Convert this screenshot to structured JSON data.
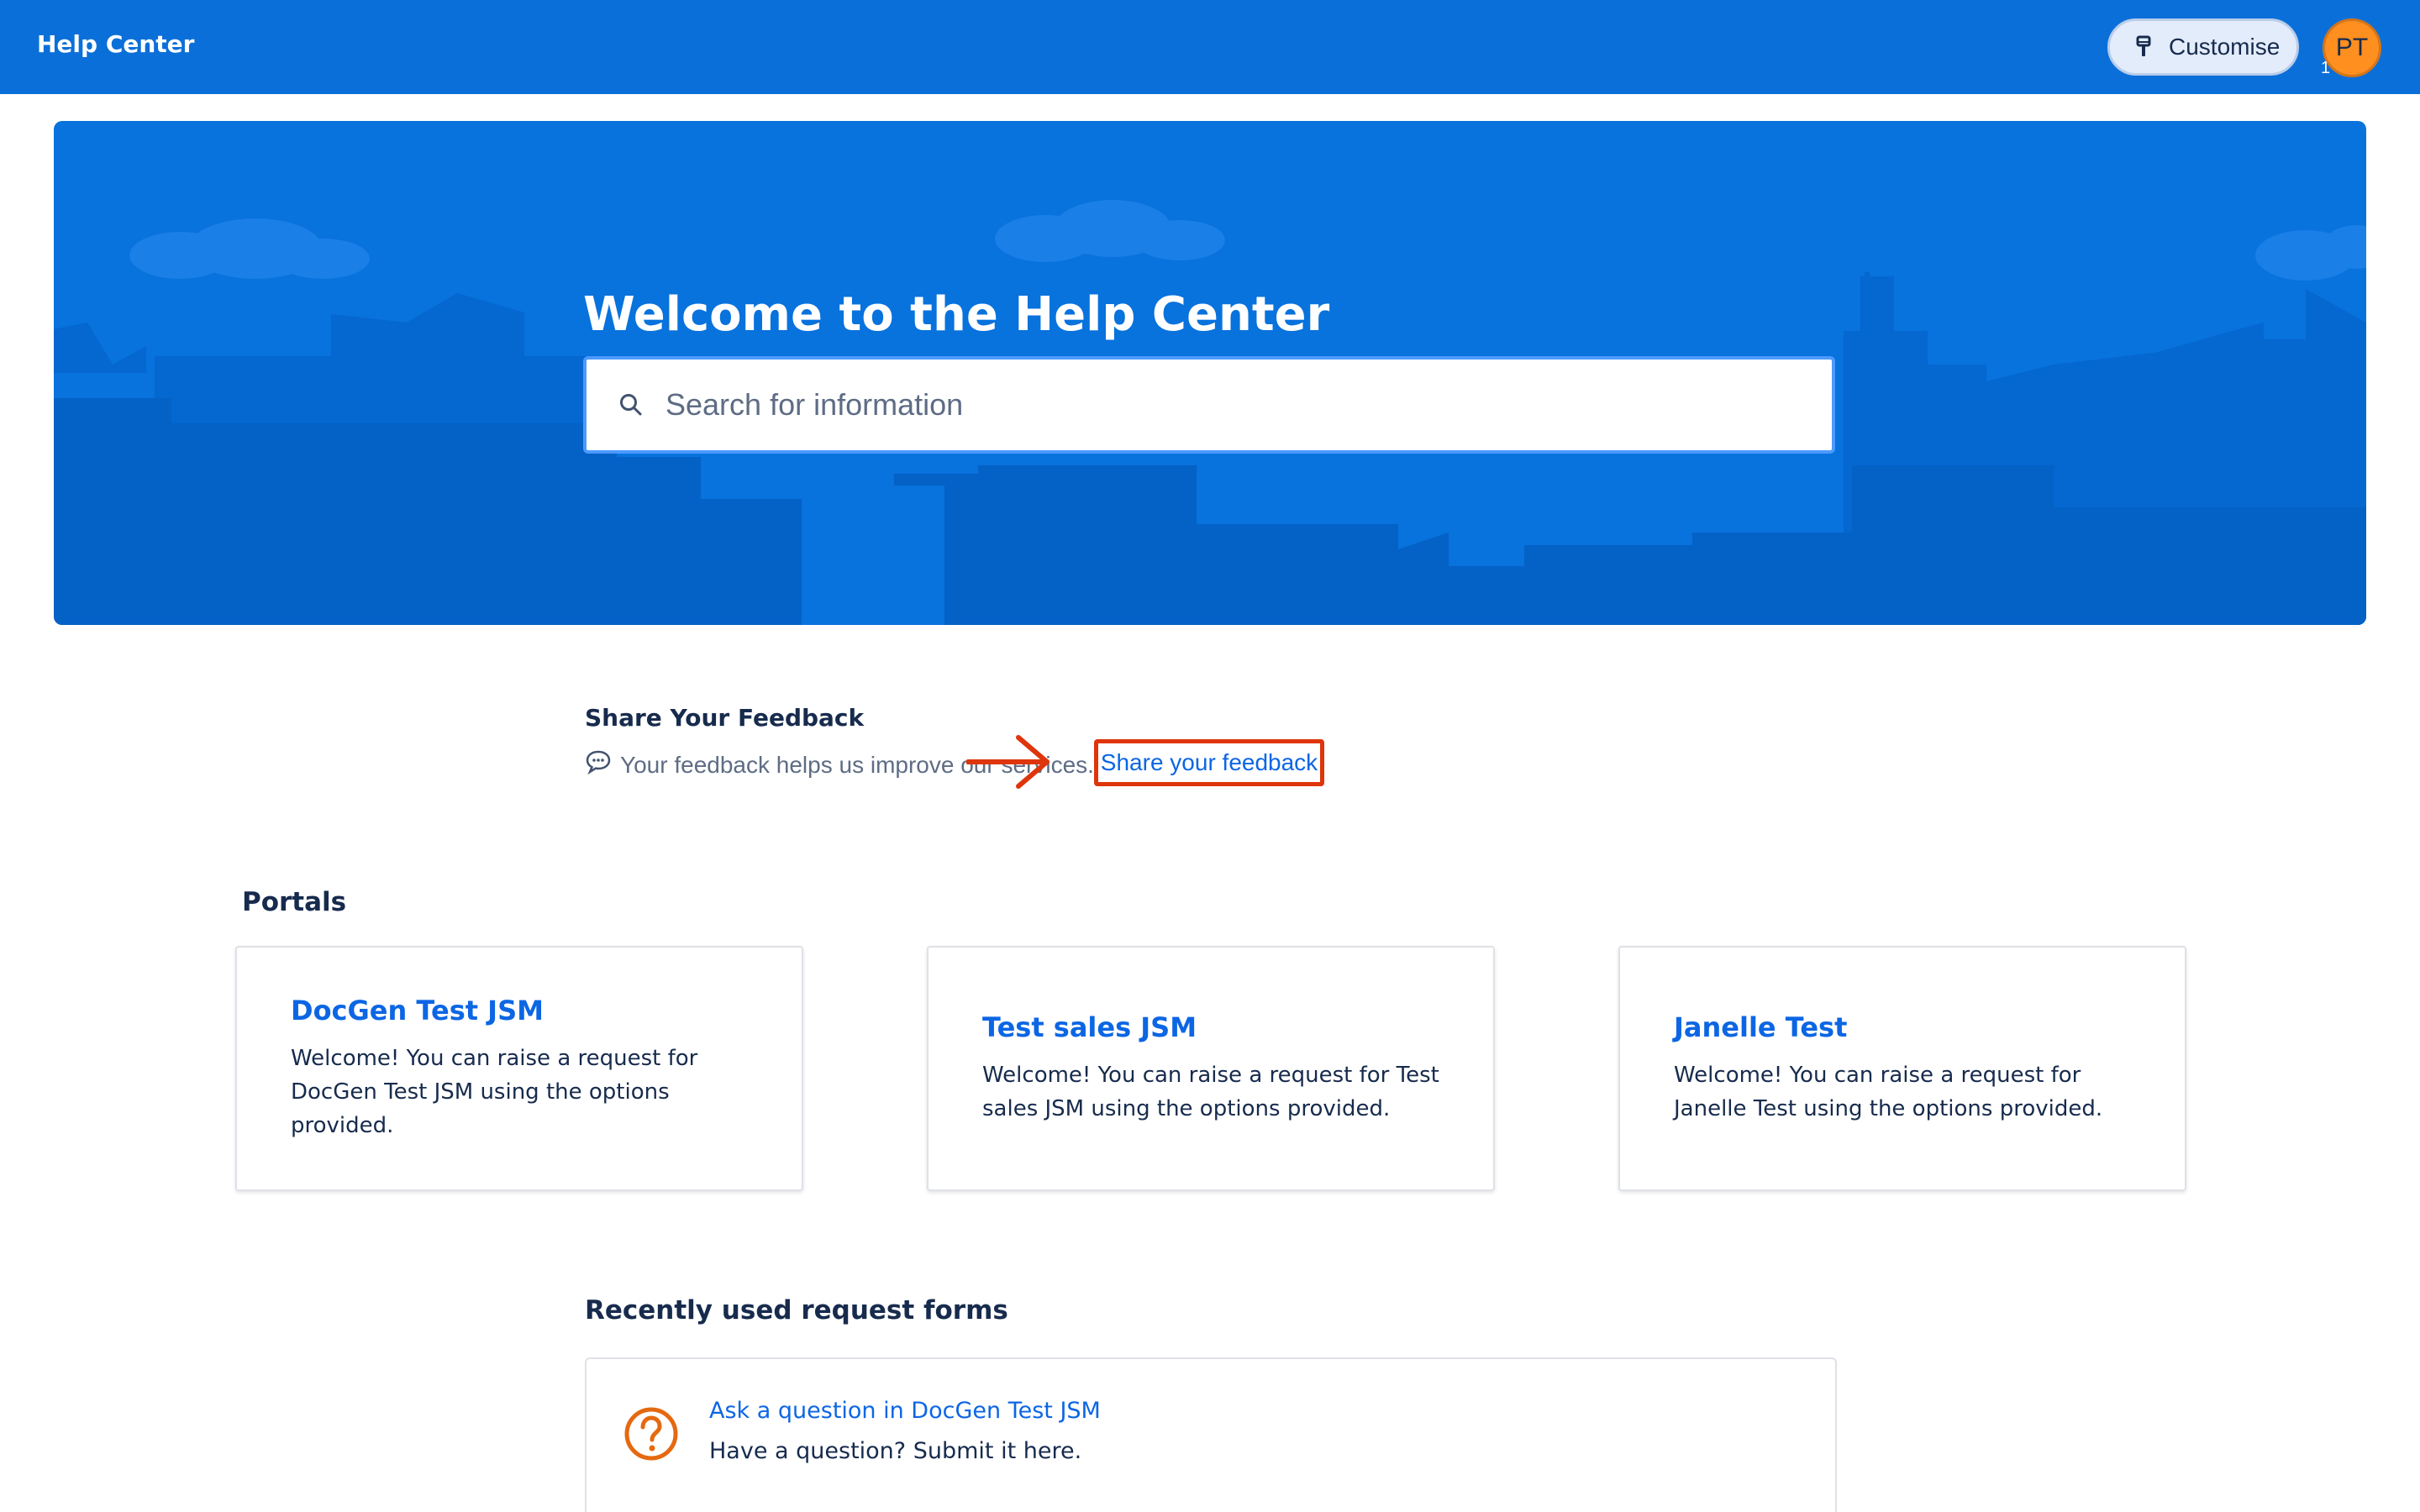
{
  "colors": {
    "topbar": "#0b6fd9",
    "hero": "#0872dd",
    "link": "#0c66e4",
    "avatar": "#ff8f1f",
    "highlight": "#de350b",
    "question_icon": "#e56910"
  },
  "header": {
    "brand": "Help Center",
    "customise_label": "Customise",
    "customise_icon": "paintbrush-icon",
    "avatar_initials": "PT",
    "avatar_badge": "1"
  },
  "hero": {
    "title": "Welcome to the Help Center",
    "search_placeholder": "Search for information",
    "search_value": "",
    "search_icon": "search-icon"
  },
  "feedback": {
    "heading": "Share Your Feedback",
    "bubble_icon": "speech-bubble-icon",
    "text": "Your feedback helps us improve our services.",
    "link_label": "Share your feedback"
  },
  "portals": {
    "heading": "Portals",
    "items": [
      {
        "title": "DocGen Test JSM",
        "description": "Welcome! You can raise a request for DocGen Test JSM using the options provided."
      },
      {
        "title": "Test sales JSM",
        "description": "Welcome! You can raise a request for Test sales JSM using the options provided."
      },
      {
        "title": "Janelle Test",
        "description": "Welcome! You can raise a request for Janelle Test using the options provided."
      }
    ]
  },
  "recent": {
    "heading": "Recently used request forms",
    "items": [
      {
        "title": "Ask a question in DocGen Test JSM",
        "description": "Have a question? Submit it here.",
        "icon": "question-circle-icon"
      }
    ]
  }
}
